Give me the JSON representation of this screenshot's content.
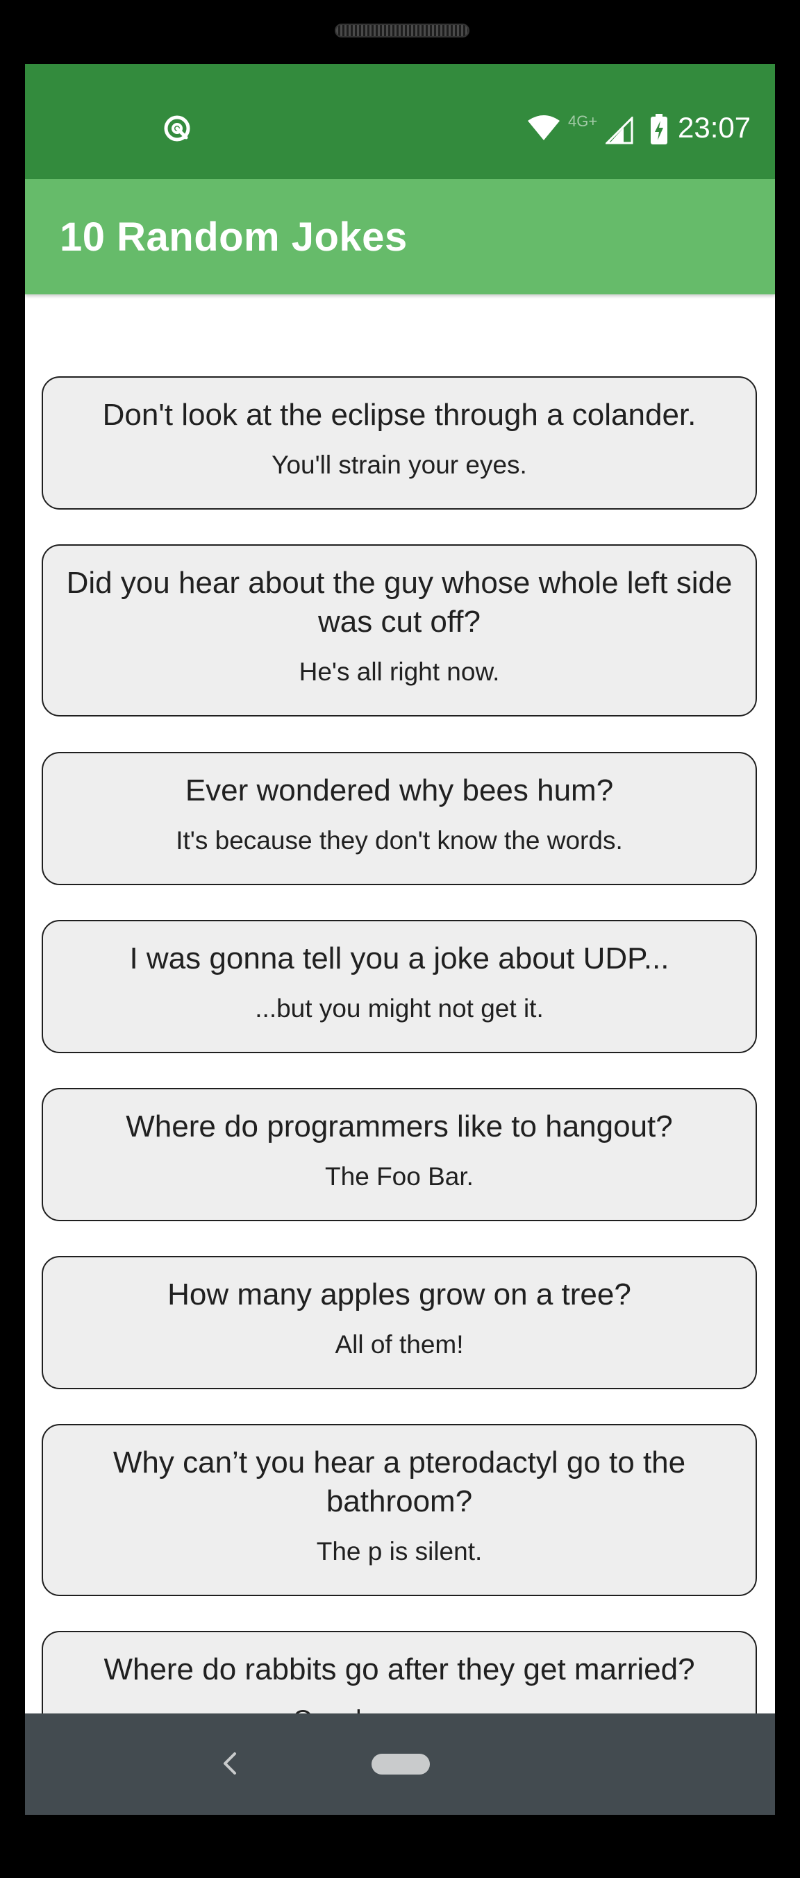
{
  "status_bar": {
    "time": "23:07",
    "network": "4G+",
    "icons": [
      "app-notification-icon",
      "wifi-icon",
      "cell-signal-icon",
      "battery-charging-icon"
    ]
  },
  "app_bar": {
    "title": "10 Random Jokes"
  },
  "jokes": [
    {
      "setup": "Don't look at the eclipse through a colander.",
      "punchline": "You'll strain your eyes."
    },
    {
      "setup": "Did you hear about the guy whose whole left side was cut off?",
      "punchline": "He's all right now."
    },
    {
      "setup": "Ever wondered why bees hum?",
      "punchline": "It's because they don't know the words."
    },
    {
      "setup": "I was gonna tell you a joke about UDP...",
      "punchline": "...but you might not get it."
    },
    {
      "setup": "Where do programmers like to hangout?",
      "punchline": "The Foo Bar."
    },
    {
      "setup": "How many apples grow on a tree?",
      "punchline": "All of them!"
    },
    {
      "setup": "Why can’t you hear a pterodactyl go to the bathroom?",
      "punchline": "The p is silent."
    },
    {
      "setup": "Where do rabbits go after they get married?",
      "punchline": "On a bunny-moon."
    }
  ],
  "nav_bar": {
    "icons": [
      "back-icon",
      "home-pill"
    ]
  },
  "colors": {
    "status_bar": "#338b3d",
    "app_bar": "#66bb6a",
    "card_bg": "#eeeeee",
    "nav_bar": "#434b50"
  }
}
